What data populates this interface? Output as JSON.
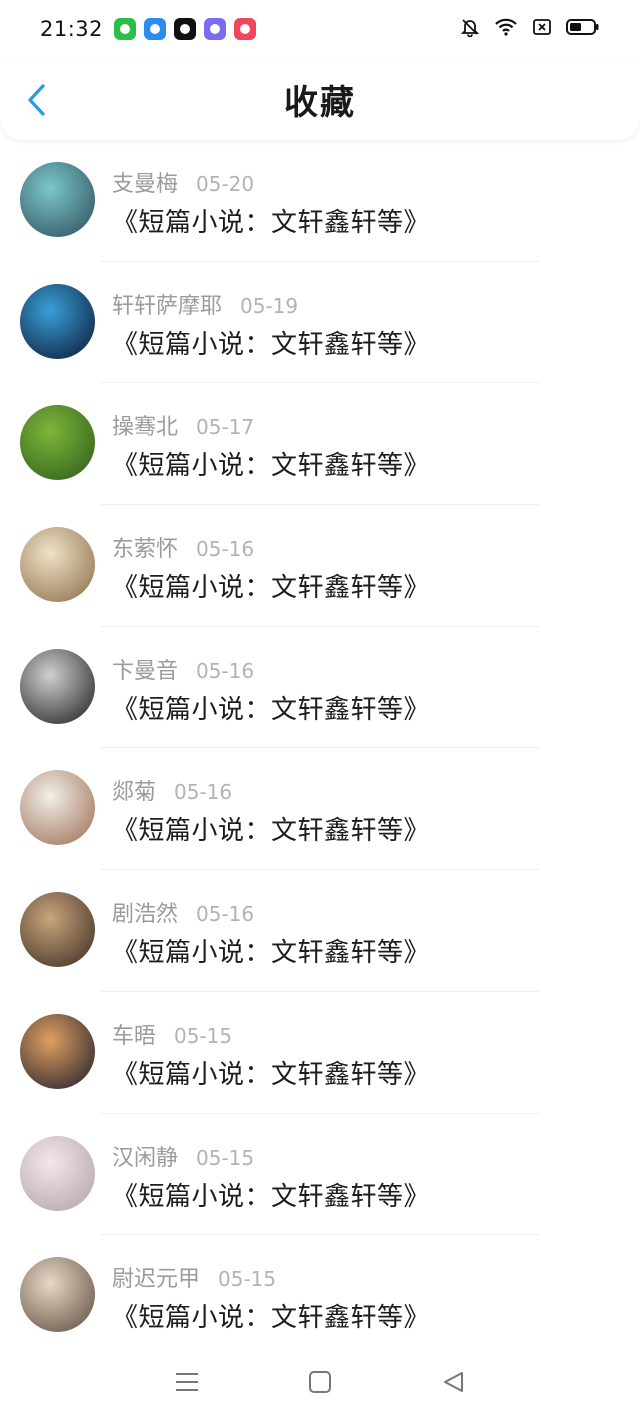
{
  "status_bar": {
    "time": "21:32",
    "app_icons": [
      {
        "name": "green-app-icon",
        "color": "#2bbf4a"
      },
      {
        "name": "blue-app-icon",
        "color": "#2a8cf0"
      },
      {
        "name": "video-app-icon",
        "color": "#111111"
      },
      {
        "name": "gradient-app-icon",
        "color": "#7a6cf0"
      },
      {
        "name": "music-app-icon",
        "color": "#f0455a"
      }
    ]
  },
  "header": {
    "title": "收藏",
    "accent_color": "#2a9ae0"
  },
  "items": [
    {
      "name": "支曼梅",
      "date": "05-20",
      "title": "《短篇小说：文轩鑫轩等》",
      "avatar_colors": [
        "#7cc7c9",
        "#2b4b5a"
      ]
    },
    {
      "name": "轩轩萨摩耶",
      "date": "05-19",
      "title": "《短篇小说：文轩鑫轩等》",
      "avatar_colors": [
        "#3aa0d8",
        "#0a1430"
      ]
    },
    {
      "name": "操骞北",
      "date": "05-17",
      "title": "《短篇小说：文轩鑫轩等》",
      "avatar_colors": [
        "#7fb63a",
        "#2b5a1a"
      ]
    },
    {
      "name": "东萦怀",
      "date": "05-16",
      "title": "《短篇小说：文轩鑫轩等》",
      "avatar_colors": [
        "#efe2c8",
        "#8a6a44"
      ]
    },
    {
      "name": "卞曼音",
      "date": "05-16",
      "title": "《短篇小说：文轩鑫轩等》",
      "avatar_colors": [
        "#d0d0d0",
        "#1a1a1a"
      ]
    },
    {
      "name": "郯菊",
      "date": "05-16",
      "title": "《短篇小说：文轩鑫轩等》",
      "avatar_colors": [
        "#f2efe8",
        "#9a6a50"
      ]
    },
    {
      "name": "剧浩然",
      "date": "05-16",
      "title": "《短篇小说：文轩鑫轩等》",
      "avatar_colors": [
        "#c8a57c",
        "#3a2a20"
      ]
    },
    {
      "name": "车晤",
      "date": "05-15",
      "title": "《短篇小说：文轩鑫轩等》",
      "avatar_colors": [
        "#e0a060",
        "#1a1a2a"
      ]
    },
    {
      "name": "汉闲静",
      "date": "05-15",
      "title": "《短篇小说：文轩鑫轩等》",
      "avatar_colors": [
        "#f4e6ea",
        "#b0a0a8"
      ]
    },
    {
      "name": "尉迟元甲",
      "date": "05-15",
      "title": "《短篇小说：文轩鑫轩等》",
      "avatar_colors": [
        "#e8d8c8",
        "#5a4a3a"
      ]
    }
  ]
}
